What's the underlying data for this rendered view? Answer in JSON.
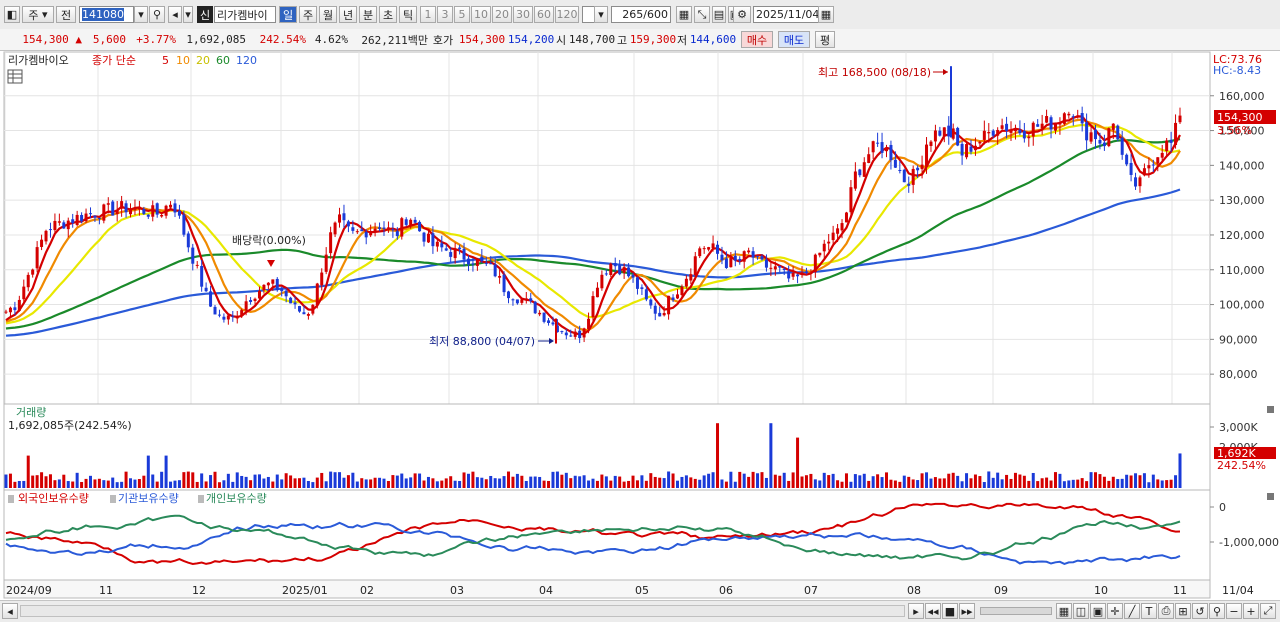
{
  "toolbar": {
    "market": "주",
    "market2": "전",
    "code": "141080",
    "shin": "신",
    "name": "리가켐바이",
    "periods": [
      "일",
      "주",
      "월",
      "년",
      "분",
      "초",
      "틱"
    ],
    "period_selected": "일",
    "intervals": [
      "1",
      "3",
      "5",
      "10",
      "20",
      "30",
      "60",
      "120"
    ],
    "count": "265",
    "count_total": "/600",
    "date": "2025/11/04"
  },
  "quote": {
    "price": "154,300",
    "change": "5,600",
    "change_rate": "+3.77%",
    "volume": "1,692,085",
    "volume_ratio": "242.54%",
    "turnover_rate": "4.62%",
    "amount": "262,211백만",
    "hoga_label": "호가",
    "ask": "154,300",
    "bid": "154,200",
    "open_label": "시",
    "open": "148,700",
    "high_label": "고",
    "high": "159,300",
    "low_label": "저",
    "low": "144,600",
    "buy": "매수",
    "sell": "매도",
    "eval": "평"
  },
  "price_panel": {
    "legend_name": "리가켐바이오",
    "legend_type": "종가 단순",
    "ma_periods": [
      "5",
      "10",
      "20",
      "60",
      "120"
    ],
    "ma_colors": [
      "#d40000",
      "#f08a00",
      "#e8e800",
      "#1a8a2a",
      "#2a5ad8"
    ],
    "lc": "LC:73.76",
    "hc": "HC:-8.43",
    "y_ticks": [
      "160,000",
      "150,000",
      "140,000",
      "130,000",
      "120,000",
      "110,000",
      "100,000",
      "90,000",
      "80,000"
    ],
    "last_price": "154,300",
    "last_pct": "3.56%",
    "annot_high": "최고 168,500 (08/18)",
    "annot_low": "최저 88,800 (04/07)",
    "annot_div": "배당락(0.00%)"
  },
  "volume_panel": {
    "title": "거래량",
    "value": "1,692,085주(242.54%)",
    "y_ticks": [
      "3,000K",
      "2,000K"
    ],
    "last_value": "1,692K",
    "last_pct": "242.54%"
  },
  "holding_panel": {
    "legend": [
      "외국인보유수량",
      "기관보유수량",
      "개인보유수량"
    ],
    "colors": [
      "#d40000",
      "#2a5ad8",
      "#2a8a5a"
    ],
    "y_ticks": [
      "0",
      "-1,000,000"
    ]
  },
  "x_axis": {
    "labels": [
      "2024/09",
      "11",
      "12",
      "2025/01",
      "02",
      "03",
      "04",
      "05",
      "06",
      "07",
      "08",
      "09",
      "10",
      "11",
      "11/04"
    ]
  },
  "chart_data": {
    "type": "candlestick",
    "ylim": [
      72000,
      172000
    ],
    "ma": [
      5,
      10,
      20,
      60,
      120
    ],
    "high": 168500,
    "high_date": "08/18",
    "low": 88800,
    "low_date": "04/07",
    "close_path": [
      [
        0,
        98000
      ],
      [
        5,
        100000
      ],
      [
        12,
        110000
      ],
      [
        20,
        122000
      ],
      [
        30,
        124000
      ],
      [
        40,
        126000
      ],
      [
        50,
        127000
      ],
      [
        60,
        128000
      ],
      [
        68,
        127000
      ],
      [
        75,
        126000
      ],
      [
        82,
        130000
      ],
      [
        88,
        120000
      ],
      [
        94,
        110000
      ],
      [
        100,
        100000
      ],
      [
        106,
        96000
      ],
      [
        112,
        96000
      ],
      [
        118,
        101000
      ],
      [
        124,
        104000
      ],
      [
        130,
        106000
      ],
      [
        136,
        104000
      ],
      [
        142,
        99000
      ],
      [
        148,
        97000
      ],
      [
        152,
        102000
      ],
      [
        156,
        112000
      ],
      [
        160,
        120000
      ],
      [
        164,
        124000
      ],
      [
        170,
        120000
      ],
      [
        176,
        121000
      ],
      [
        184,
        123000
      ],
      [
        192,
        120000
      ],
      [
        198,
        126000
      ],
      [
        204,
        121000
      ],
      [
        210,
        117000
      ],
      [
        220,
        115000
      ],
      [
        230,
        113000
      ],
      [
        240,
        110000
      ],
      [
        246,
        104000
      ],
      [
        252,
        102000
      ],
      [
        258,
        100000
      ],
      [
        264,
        97000
      ],
      [
        270,
        94000
      ],
      [
        276,
        92000
      ],
      [
        282,
        91000
      ],
      [
        286,
        96000
      ],
      [
        292,
        108000
      ],
      [
        298,
        112000
      ],
      [
        304,
        110000
      ],
      [
        310,
        106000
      ],
      [
        316,
        100000
      ],
      [
        322,
        97000
      ],
      [
        326,
        101000
      ],
      [
        330,
        104000
      ],
      [
        336,
        109000
      ],
      [
        342,
        117000
      ],
      [
        348,
        116000
      ],
      [
        354,
        112000
      ],
      [
        360,
        112000
      ],
      [
        366,
        115000
      ],
      [
        370,
        112000
      ],
      [
        374,
        111000
      ],
      [
        380,
        110000
      ],
      [
        386,
        107000
      ],
      [
        392,
        108000
      ],
      [
        398,
        112000
      ],
      [
        404,
        118000
      ],
      [
        410,
        121000
      ],
      [
        414,
        127000
      ],
      [
        418,
        137000
      ],
      [
        424,
        143000
      ],
      [
        430,
        146000
      ],
      [
        436,
        143000
      ],
      [
        442,
        136000
      ],
      [
        448,
        137000
      ],
      [
        454,
        148000
      ],
      [
        460,
        150000
      ],
      [
        466,
        149000
      ],
      [
        470,
        143000
      ],
      [
        476,
        146000
      ],
      [
        482,
        148000
      ],
      [
        488,
        152000
      ],
      [
        494,
        151000
      ],
      [
        500,
        150000
      ],
      [
        506,
        151000
      ],
      [
        512,
        152000
      ],
      [
        518,
        153000
      ],
      [
        524,
        158000
      ],
      [
        530,
        150000
      ],
      [
        536,
        149000
      ],
      [
        540,
        146000
      ],
      [
        546,
        153000
      ],
      [
        550,
        141000
      ],
      [
        554,
        135000
      ],
      [
        558,
        134000
      ],
      [
        562,
        140000
      ],
      [
        566,
        143000
      ],
      [
        570,
        146000
      ],
      [
        574,
        146000
      ],
      [
        578,
        154300
      ]
    ]
  }
}
